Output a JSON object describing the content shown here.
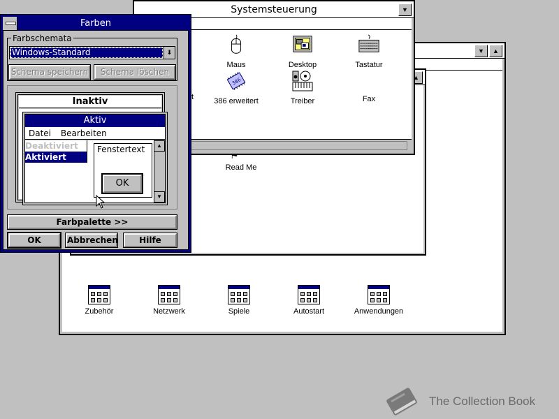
{
  "program_manager": {
    "title": "",
    "groups": [
      {
        "label": "Zubehör"
      },
      {
        "label": "Netzwerk"
      },
      {
        "label": "Spiele"
      },
      {
        "label": "Autostart"
      },
      {
        "label": "Anwendungen"
      }
    ]
  },
  "main_group": {
    "items": [
      {
        "label": "Read Me"
      }
    ]
  },
  "control_panel": {
    "title": "Systemsteuerung",
    "items": [
      {
        "label": "Maus",
        "icon": "mouse-icon"
      },
      {
        "label": "Desktop",
        "icon": "desktop-icon"
      },
      {
        "label": "Tastatur",
        "icon": "keyboard-icon"
      },
      {
        "label": "386 erweitert",
        "icon": "chip-icon"
      },
      {
        "label": "Treiber",
        "icon": "drivers-icon"
      },
      {
        "label": "Fax",
        "icon": ""
      }
    ],
    "partial_label": "t"
  },
  "colors_dialog": {
    "title": "Farben",
    "scheme_group_label": "Farbschemata",
    "scheme_selected": "Windows-Standard",
    "save_scheme": "Schema speichern",
    "delete_scheme": "Schema löschen",
    "preview": {
      "inactive_title": "Inaktiv",
      "active_title": "Aktiv",
      "menu_file": "Datei",
      "menu_edit": "Bearbeiten",
      "disabled_item": "Deaktiviert",
      "highlighted_item": "Aktiviert",
      "window_text": "Fenstertext",
      "ok": "OK"
    },
    "palette_button": "Farbpalette >>",
    "ok_button": "OK",
    "cancel_button": "Abbrechen",
    "help_button": "Hilfe"
  },
  "watermark": {
    "text": "The Collection Book"
  },
  "colors": {
    "desktop": "#c0c0c0",
    "active_title": "#000080",
    "highlight": "#000080"
  }
}
